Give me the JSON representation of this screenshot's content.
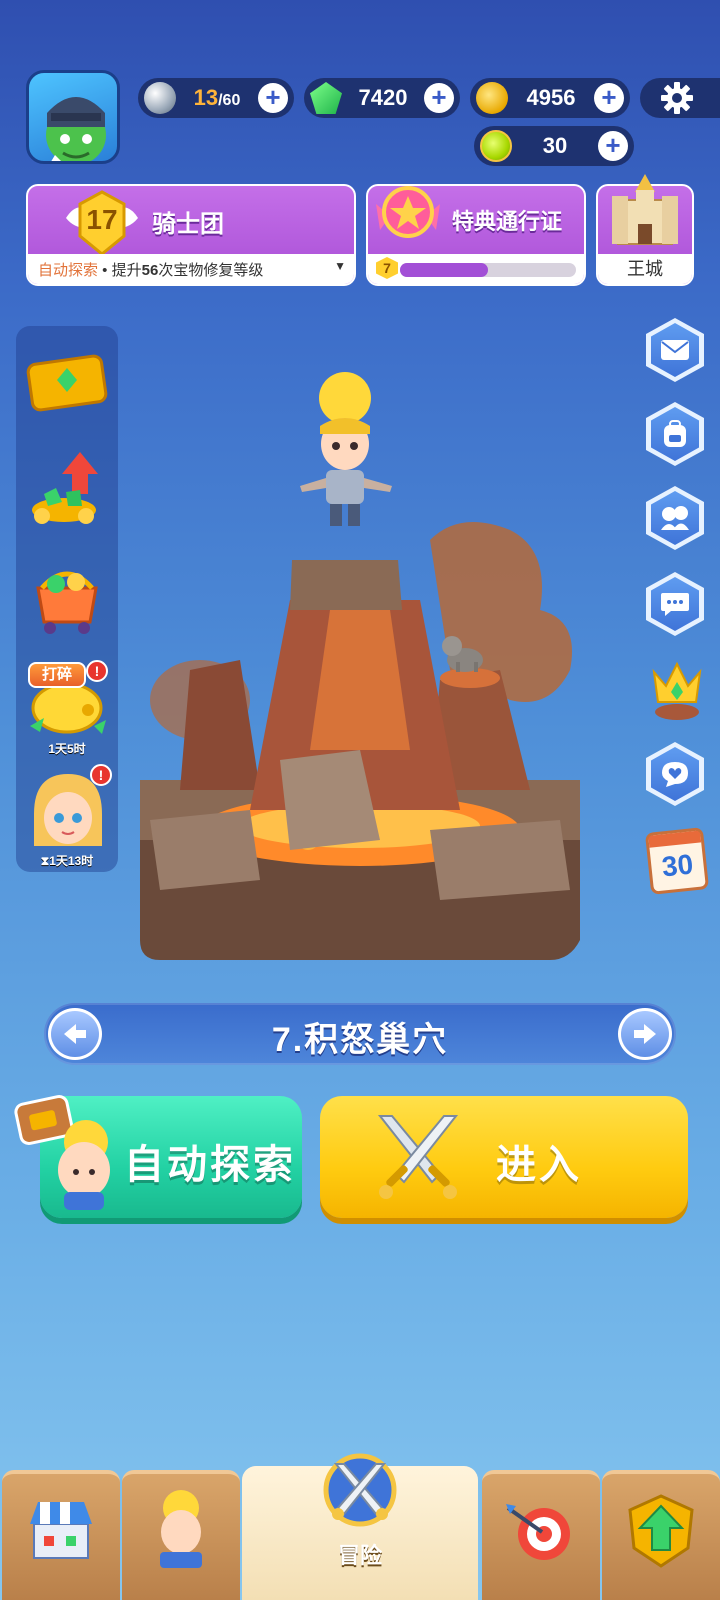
{
  "resources": {
    "stamina_current": "13",
    "stamina_max": "/60",
    "gems": "7420",
    "coins": "4956",
    "tokens": "30"
  },
  "banners": {
    "guild_level": "17",
    "guild_title": "骑士团",
    "guild_tip_highlight": "自动探索",
    "guild_tip_sep": " • ",
    "guild_tip_prefix": "提升",
    "guild_tip_count": "56",
    "guild_tip_suffix": "次宝物修复等级",
    "pass_title": "特典通行证",
    "pass_level": "7",
    "pass_progress": 0.5,
    "castle_label": "王城"
  },
  "side_panel": {
    "smash_label": "打碎",
    "smash_timer": "1天5时",
    "hero_timer": "1天13时",
    "badge": "!"
  },
  "right_buttons": {
    "calendar_days": "30"
  },
  "level": {
    "title": "7.积怒巢穴"
  },
  "actions": {
    "auto_explore": "自动探索",
    "enter": "进入"
  },
  "nav": {
    "adventure": "冒险"
  },
  "colors": {
    "auto_button": "#22d1a3",
    "enter_button": "#ffcb10",
    "banner_purple": "#b45ddc"
  }
}
